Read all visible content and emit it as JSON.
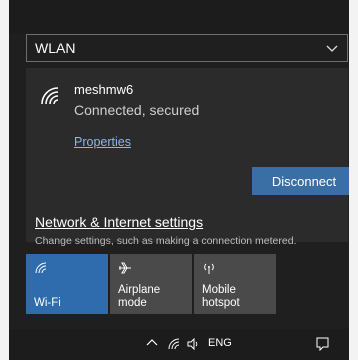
{
  "network_selector": {
    "label": "WLAN",
    "icon": "chevron-down-icon"
  },
  "network": {
    "ssid": "meshmw6",
    "status": "Connected, secured",
    "properties_label": "Properties",
    "disconnect_label": "Disconnect",
    "icon": "wifi-icon"
  },
  "settings": {
    "link_label": "Network & Internet settings",
    "description": "Change settings, such as making a connection metered."
  },
  "quick_actions": [
    {
      "label": "Wi-Fi",
      "icon": "wifi-icon",
      "active": true
    },
    {
      "label": "Airplane mode",
      "icon": "airplane-icon",
      "active": false
    },
    {
      "label": "Mobile\nhotspot",
      "icon": "hotspot-icon",
      "active": false
    }
  ],
  "taskbar": {
    "language": "ENG"
  },
  "colors": {
    "accent": "#2e6cae",
    "button": "#3a6fa6",
    "panel": "#1f1f1f",
    "item": "#2b2b2b"
  }
}
